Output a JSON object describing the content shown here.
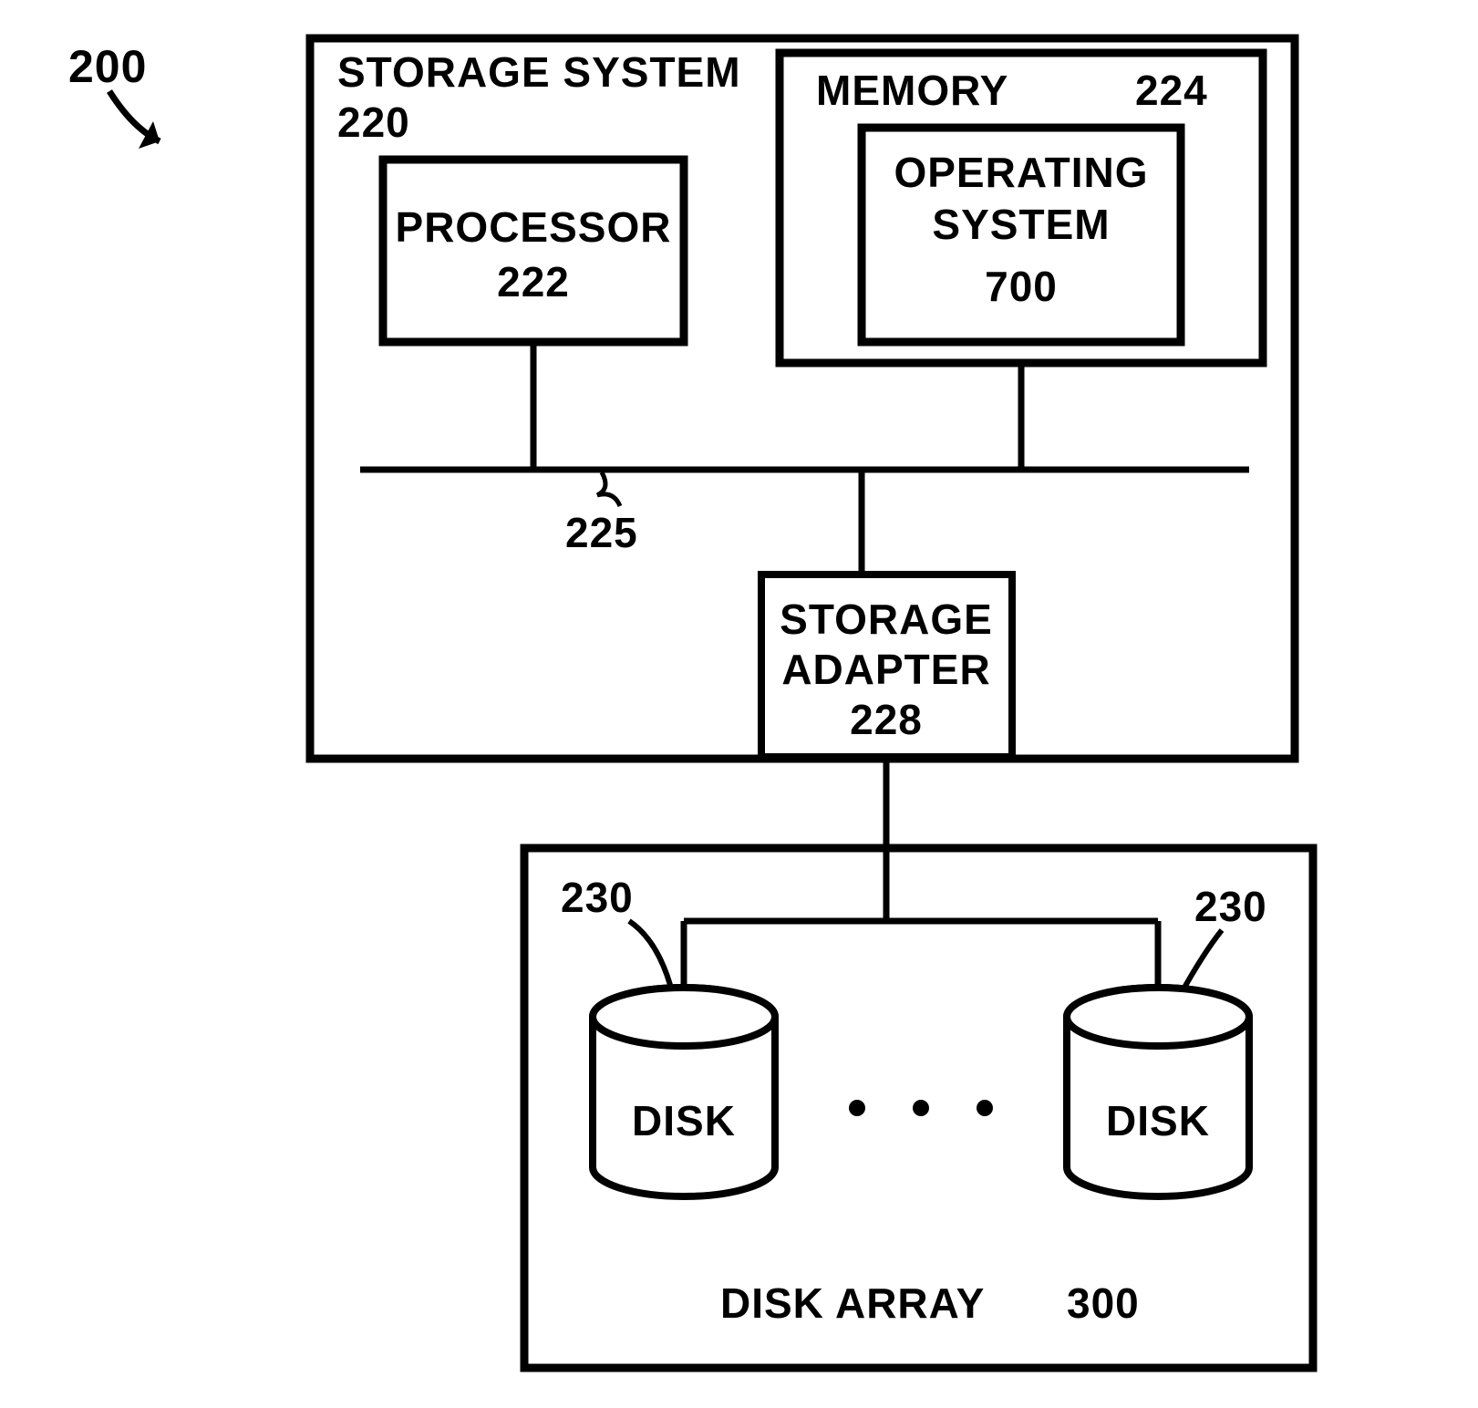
{
  "fig": {
    "number": "200"
  },
  "storageSystem": {
    "title": "STORAGE SYSTEM",
    "number": "220",
    "processor": {
      "title": "PROCESSOR",
      "number": "222"
    },
    "memory": {
      "title": "MEMORY",
      "number": "224",
      "os": {
        "title_line1": "OPERATING",
        "title_line2": "SYSTEM",
        "number": "700"
      }
    },
    "bus": {
      "number": "225"
    },
    "storageAdapter": {
      "title_line1": "STORAGE",
      "title_line2": "ADAPTER",
      "number": "228"
    }
  },
  "diskArray": {
    "title": "DISK ARRAY",
    "number": "300",
    "diskRefLeft": "230",
    "diskRefRight": "230",
    "diskLabel": "DISK"
  }
}
